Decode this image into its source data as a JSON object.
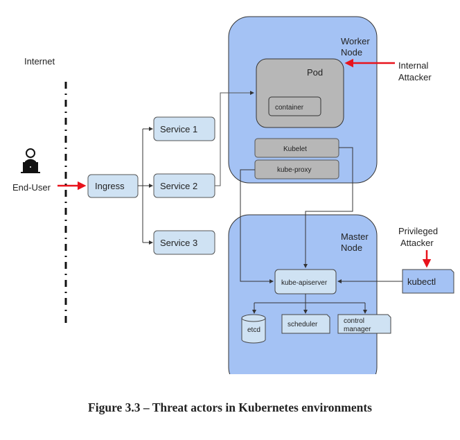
{
  "diagram": {
    "internet_label": "Internet",
    "end_user_label": "End-User",
    "ingress_label": "Ingress",
    "services": [
      "Service 1",
      "Service 2",
      "Service 3"
    ],
    "worker_node": {
      "title_line1": "Worker",
      "title_line2": "Node",
      "pod_label": "Pod",
      "container_label": "container",
      "kubelet_label": "Kubelet",
      "kube_proxy_label": "kube-proxy"
    },
    "master_node": {
      "title_line1": "Master",
      "title_line2": "Node",
      "apiserver_label": "kube-apiserver",
      "etcd_label": "etcd",
      "scheduler_label": "scheduler",
      "control_manager_line1": "control",
      "control_manager_line2": "manager"
    },
    "internal_attacker_line1": "Internal",
    "internal_attacker_line2": "Attacker",
    "privileged_attacker_line1": "Privileged",
    "privileged_attacker_line2": "Attacker",
    "kubectl_label": "kubectl",
    "colors": {
      "node_fill": "#a4c2f4",
      "box_fill": "#cfe2f3",
      "gray_fill": "#b7b7b7",
      "attacker_arrow": "#e8121b"
    }
  },
  "caption": "Figure 3.3 – Threat actors in Kubernetes environments"
}
